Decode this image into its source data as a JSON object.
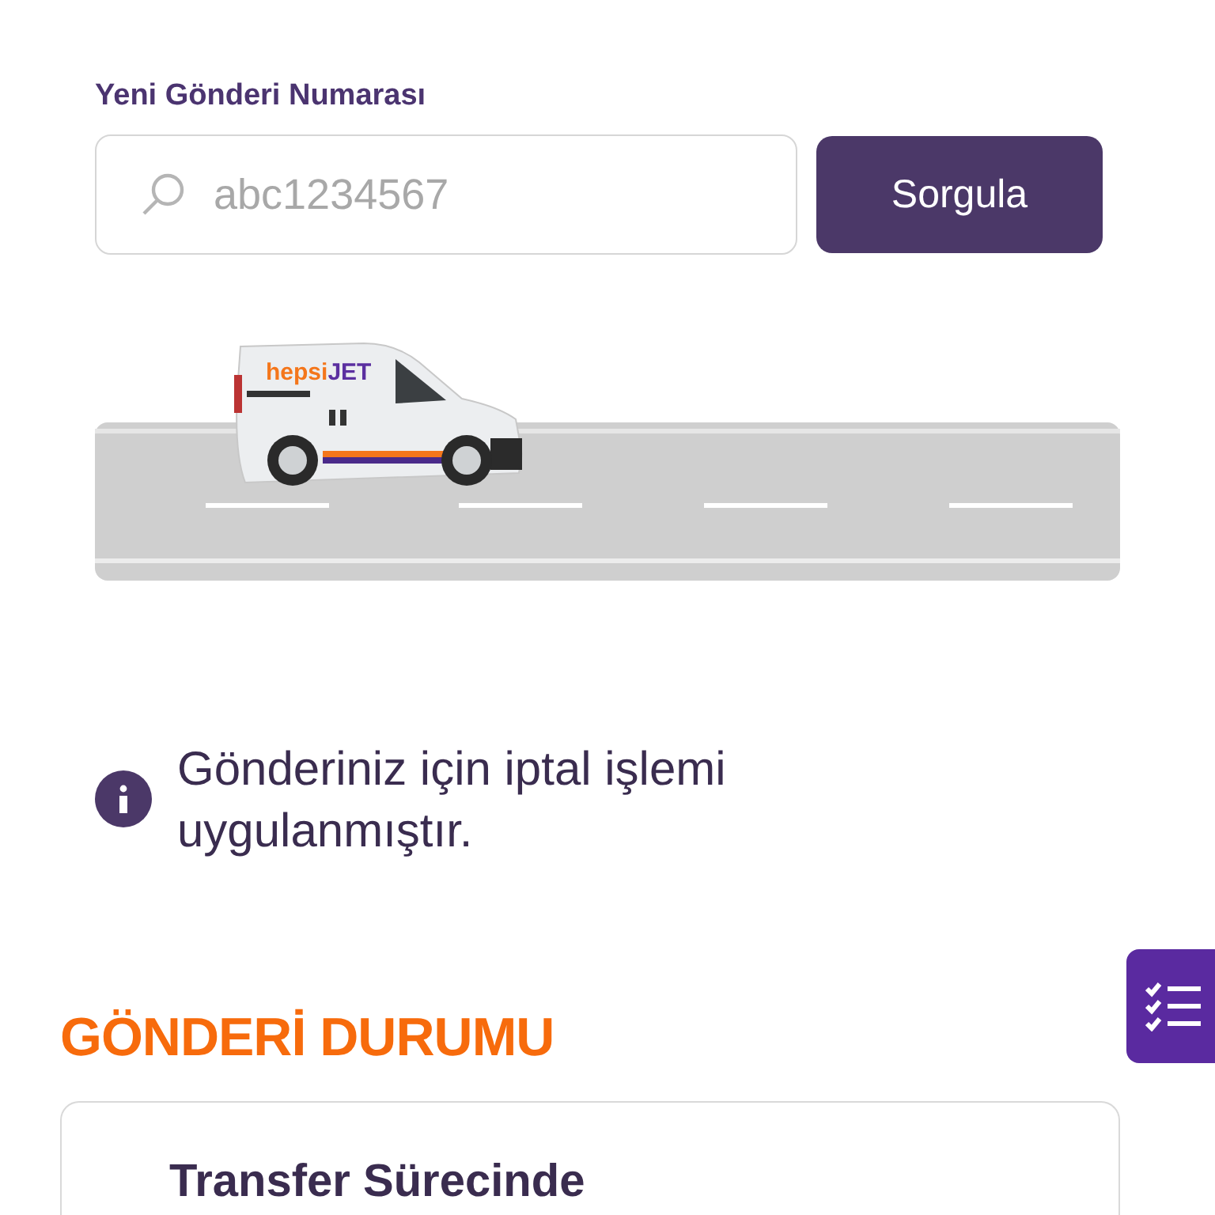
{
  "search": {
    "label": "Yeni Gönderi Numarası",
    "placeholder": "abc1234567",
    "button": "Sorgula"
  },
  "van_logo": {
    "first": "hepsi",
    "second": "JET"
  },
  "notice": "Gönderiniz için iptal işlemi uygulanmıştır.",
  "status": {
    "heading": "GÖNDERİ DURUMU",
    "card_title": "Transfer Sürecinde"
  }
}
